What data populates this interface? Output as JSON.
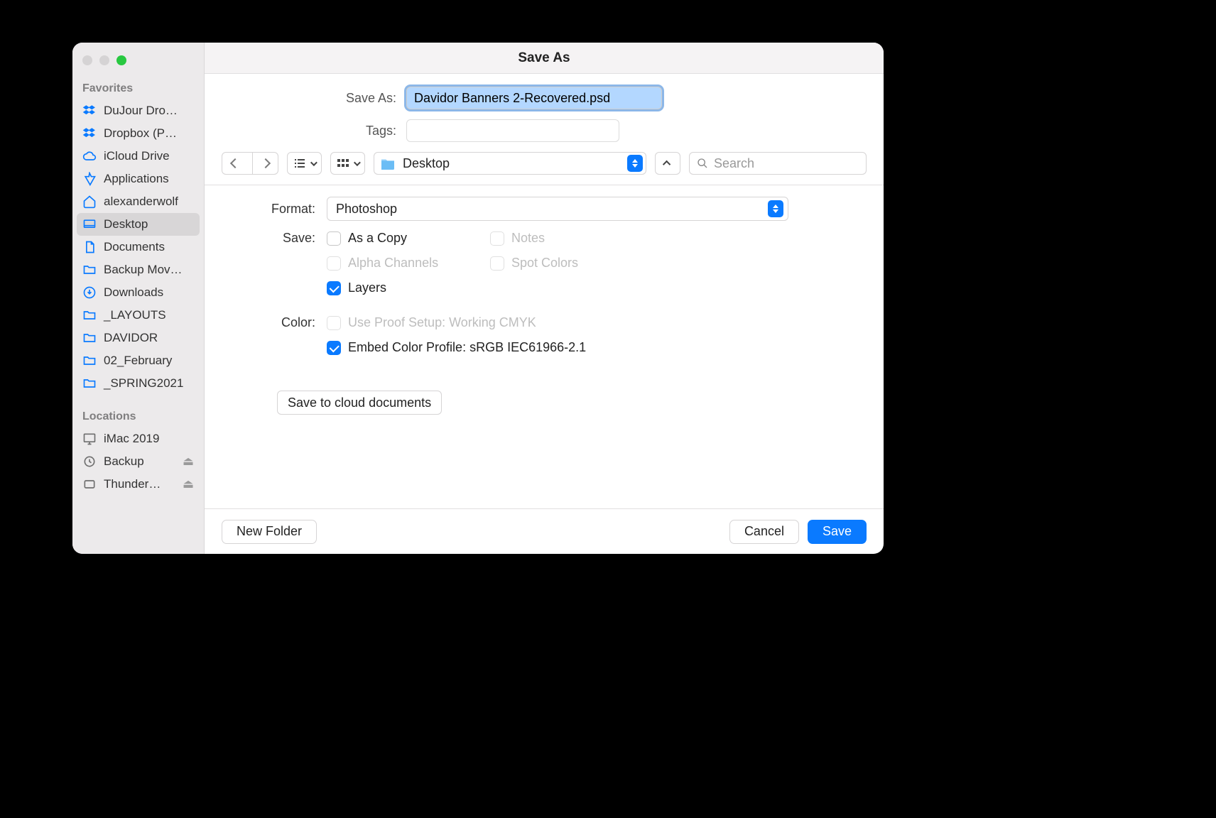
{
  "window": {
    "title": "Save As"
  },
  "sidebar": {
    "sections": {
      "favorites": "Favorites",
      "locations": "Locations"
    },
    "favorites": [
      {
        "icon": "dropbox",
        "label": "DuJour Dro…"
      },
      {
        "icon": "dropbox",
        "label": "Dropbox (P…"
      },
      {
        "icon": "cloud",
        "label": "iCloud Drive"
      },
      {
        "icon": "apps",
        "label": "Applications"
      },
      {
        "icon": "home",
        "label": "alexanderwolf"
      },
      {
        "icon": "desktop",
        "label": "Desktop",
        "selected": true
      },
      {
        "icon": "doc",
        "label": "Documents"
      },
      {
        "icon": "folder",
        "label": "Backup Mov…"
      },
      {
        "icon": "download",
        "label": "Downloads"
      },
      {
        "icon": "folder",
        "label": "_LAYOUTS"
      },
      {
        "icon": "folder",
        "label": "DAVIDOR"
      },
      {
        "icon": "folder",
        "label": "02_February"
      },
      {
        "icon": "folder",
        "label": "_SPRING2021"
      }
    ],
    "locations": [
      {
        "icon": "computer",
        "label": "iMac 2019",
        "eject": false
      },
      {
        "icon": "time",
        "label": "Backup",
        "eject": true
      },
      {
        "icon": "disk",
        "label": "Thunder…",
        "eject": true
      }
    ]
  },
  "header": {
    "saveas_label": "Save As:",
    "saveas_value": "Davidor Banners 2-Recovered.psd",
    "tags_label": "Tags:",
    "location": "Desktop",
    "search_placeholder": "Search"
  },
  "options": {
    "format_label": "Format:",
    "format_value": "Photoshop",
    "save_label": "Save:",
    "color_label": "Color:",
    "as_a_copy": "As a Copy",
    "notes": "Notes",
    "alpha_channels": "Alpha Channels",
    "spot_colors": "Spot Colors",
    "layers": "Layers",
    "proof_setup": "Use Proof Setup:  Working CMYK",
    "embed_profile": "Embed Color Profile:  sRGB IEC61966-2.1",
    "cloud_button": "Save to cloud documents"
  },
  "footer": {
    "new_folder": "New Folder",
    "cancel": "Cancel",
    "save": "Save"
  }
}
